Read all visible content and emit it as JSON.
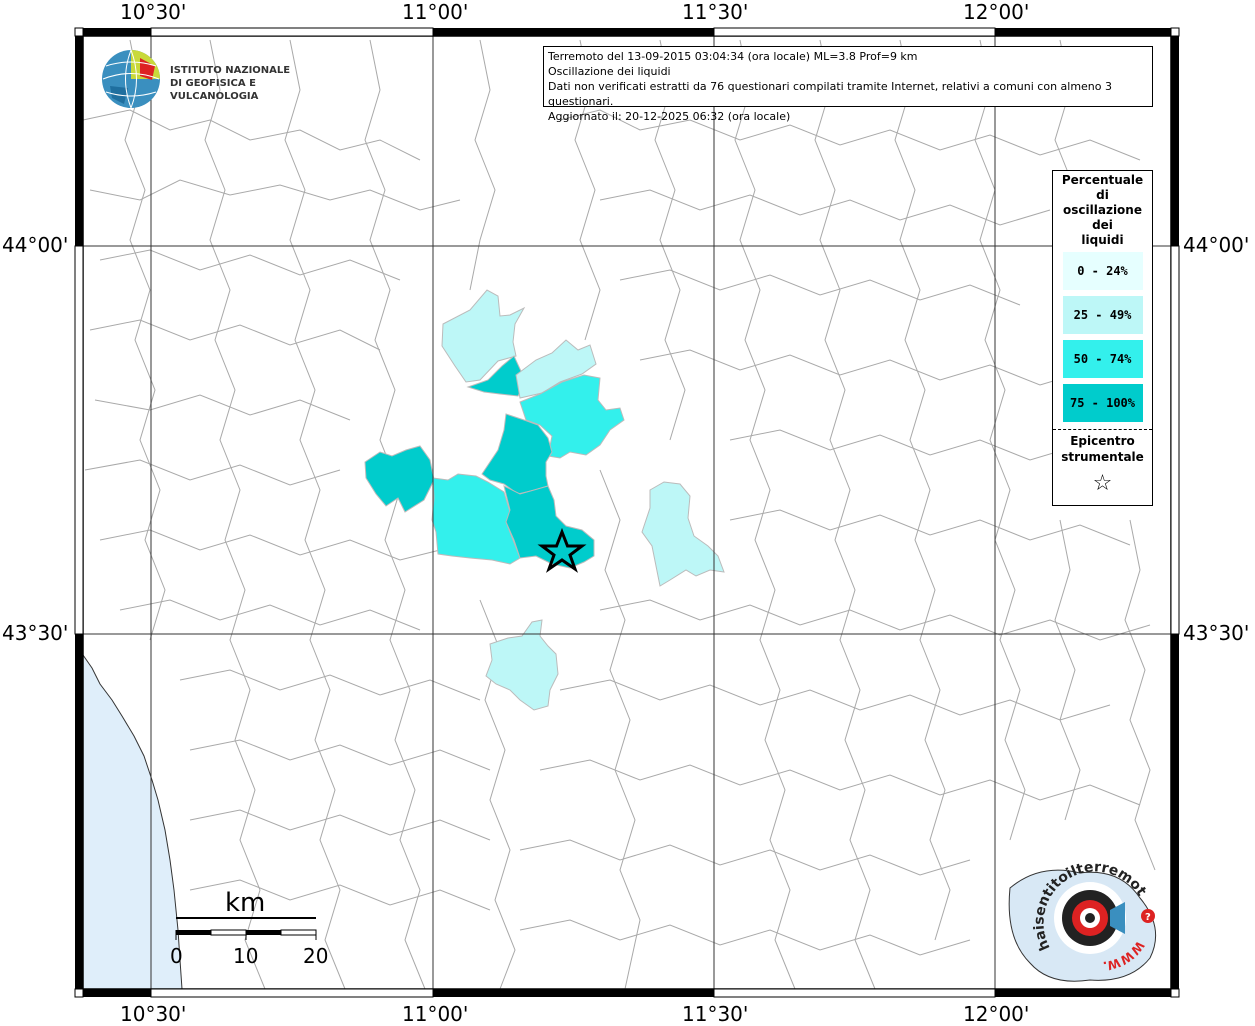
{
  "map": {
    "lon_labels": [
      "10°30'",
      "11°00'",
      "11°30'",
      "12°00'"
    ],
    "lat_labels": [
      "44°00'",
      "43°30'"
    ],
    "colors": {
      "sea": "#dfeefa",
      "boundary": "#a9a9a9",
      "class_0_24": "#e6ffff",
      "class_25_49": "#bdf7f7",
      "class_50_74": "#33f0ec",
      "class_75_100": "#00cccc"
    }
  },
  "info": {
    "line1": "Terremoto del 13-09-2015 03:04:34 (ora locale) ML=3.8 Prof=9 km",
    "line2": "Oscillazione dei liquidi",
    "line3": "Dati non verificati estratti da 76 questionari compilati tramite Internet, relativi a comuni con almeno 3 questionari.",
    "line4": "Aggiornato il: 20-12-2025 06:32 (ora locale)"
  },
  "logo": {
    "line1": "ISTITUTO NAZIONALE",
    "line2": "DI GEOFISICA E VULCANOLOGIA"
  },
  "legend": {
    "title_lines": [
      "Percentuale",
      "di",
      "oscillazione",
      "dei",
      "liquidi"
    ],
    "classes": [
      "0 - 24%",
      "25 - 49%",
      "50 - 74%",
      "75 - 100%"
    ],
    "epicenter_lines": [
      "Epicentro",
      "strumentale"
    ],
    "star_glyph": "☆"
  },
  "scale": {
    "unit": "km",
    "ticks": [
      "0",
      "10",
      "20"
    ]
  },
  "hst_logo": {
    "text": "haisentitoilterremoto.it",
    "www": "WWW."
  }
}
